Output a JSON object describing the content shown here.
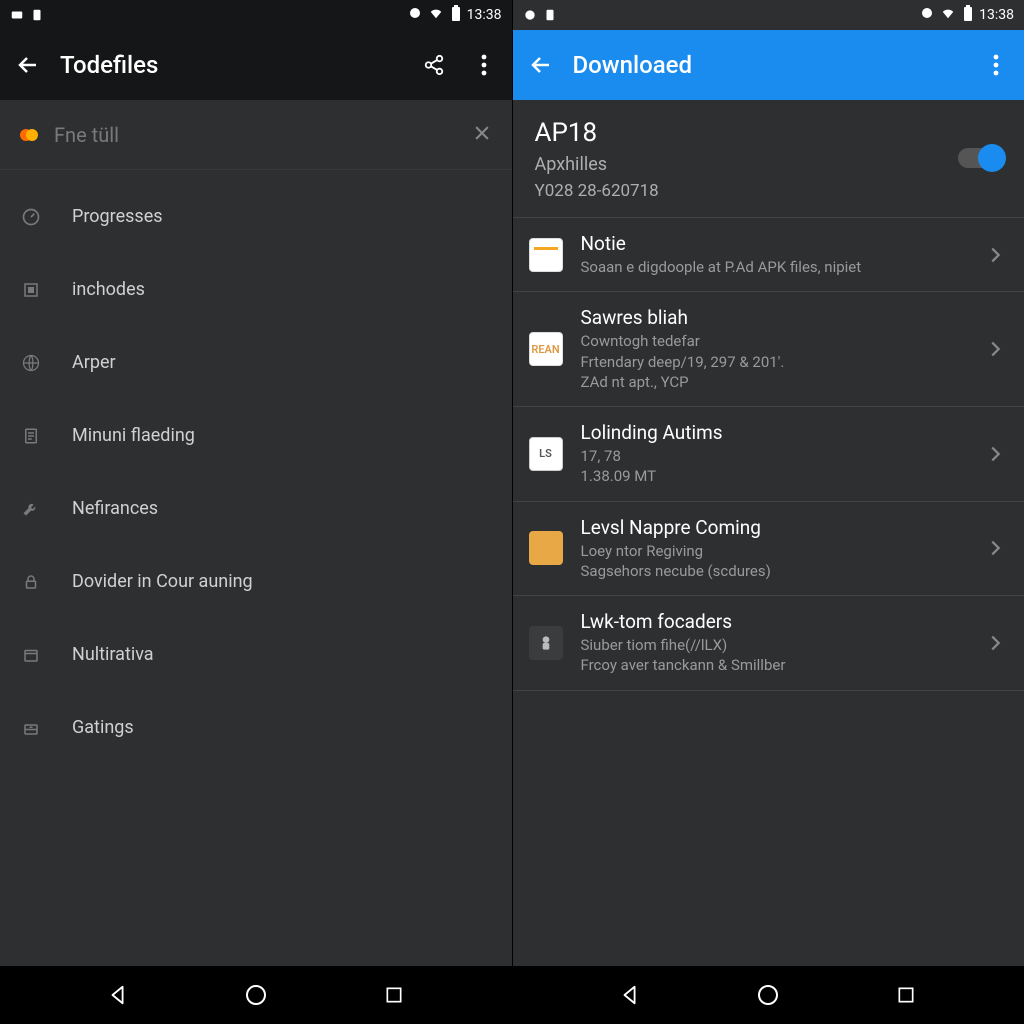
{
  "status_time": "13:38",
  "left": {
    "title": "Todefiles",
    "search_label": "Fne tüll",
    "menu": [
      {
        "id": "progresses",
        "label": "Progresses",
        "icon": "gauge"
      },
      {
        "id": "inchodes",
        "label": "inchodes",
        "icon": "square"
      },
      {
        "id": "arper",
        "label": "Arper",
        "icon": "globe"
      },
      {
        "id": "minuni",
        "label": "Minuni flaeding",
        "icon": "doc"
      },
      {
        "id": "nefirances",
        "label": "Nefirances",
        "icon": "wrench"
      },
      {
        "id": "dovider",
        "label": "Dovider in Cour auning",
        "icon": "lock"
      },
      {
        "id": "nultirativa",
        "label": "Nultirativa",
        "icon": "box"
      },
      {
        "id": "gatings",
        "label": "Gatings",
        "icon": "drawer"
      }
    ]
  },
  "right": {
    "title": "Downloaed",
    "header": {
      "title": "AP18",
      "sub1": "Apxhilles",
      "sub2": "Y028 28-620718"
    },
    "items": [
      {
        "icon": "doc1",
        "title": "Notie",
        "sub": "Soaan e digdoople at P.Ad APK files, nipiet"
      },
      {
        "icon": "doc2",
        "icon_text": "REAN",
        "title": "Sawres bliah",
        "sub": "Cowntogh tedefar\nFrtendary deep/19, 297 & 201'.\nZAd nt apt., YCP"
      },
      {
        "icon": "ls",
        "icon_text": "LS",
        "title": "Lolinding Autims",
        "sub": "17, 78\n1.38.09 MT"
      },
      {
        "icon": "fold",
        "title": "Levsl Nappre Coming",
        "sub": "Loey ntor Regiving\nSagsehors necube (scdures)"
      },
      {
        "icon": "app",
        "title": "Lwk-tom focaders",
        "sub": "Siuber tiom fihe(//lLX)\nFrcoy aver tanckann & Smillber"
      }
    ]
  }
}
